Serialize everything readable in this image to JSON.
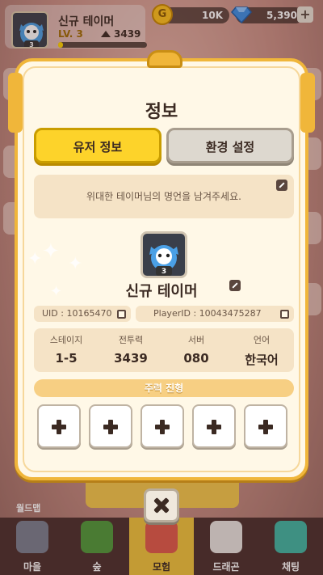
{
  "header": {
    "player_name": "신규 테이머",
    "level": "LV. 3",
    "power": "3439",
    "exp_progress": 0.05,
    "gold": "10K",
    "gems": "5,390",
    "gold_icon_glyph": "G",
    "plus_glyph": "+"
  },
  "modal": {
    "title": "정보",
    "tabs": [
      {
        "label": "유저 정보",
        "active": true
      },
      {
        "label": "환경 설정",
        "active": false
      }
    ],
    "motto": "위대한 테이머님의 명언을 남겨주세요.",
    "nickname": "신규 테이머",
    "uid": "UID : 10165470",
    "player_id": "PlayerID : 10043475287",
    "stats": [
      {
        "label": "스테이지",
        "value": "1-5"
      },
      {
        "label": "전투력",
        "value": "3439"
      },
      {
        "label": "서버",
        "value": "080"
      },
      {
        "label": "언어",
        "value": "한국어"
      }
    ],
    "formation_title": "주력 진형",
    "formation_slots": 5,
    "avatar_badge": "3"
  },
  "bottom_nav": {
    "items": [
      {
        "label": "마을",
        "icon": "village-icon"
      },
      {
        "label": "숲",
        "icon": "forest-icon"
      },
      {
        "label": "모험",
        "icon": "compass-icon",
        "active": true
      },
      {
        "label": "드래곤",
        "icon": "dragon-icon"
      },
      {
        "label": "채팅",
        "icon": "chat-icon"
      }
    ],
    "worldmap_label": "월드맵"
  },
  "colors": {
    "accent_gold": "#f0b63a",
    "tab_active": "#fdd32a",
    "tab_inactive": "#ddd8cf",
    "panel_bg": "#fff8e7"
  }
}
